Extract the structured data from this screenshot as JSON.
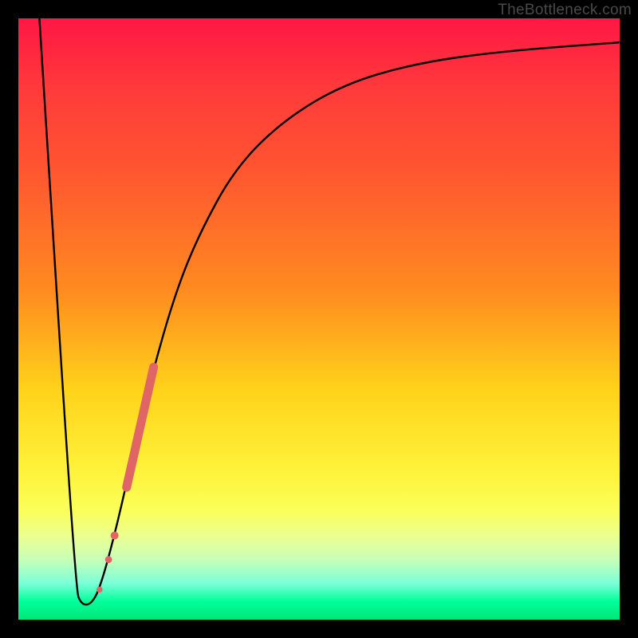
{
  "watermark": "TheBottleneck.com",
  "colors": {
    "curve_stroke": "#000000",
    "marker_fill": "#e06666",
    "marker_stroke": "#e06666"
  },
  "chart_data": {
    "type": "line",
    "title": "",
    "xlabel": "",
    "ylabel": "",
    "xlim": [
      0,
      100
    ],
    "ylim": [
      0,
      100
    ],
    "curve_points": [
      {
        "x": 3.5,
        "y": 100
      },
      {
        "x": 9.5,
        "y": 5
      },
      {
        "x": 10.5,
        "y": 2.5
      },
      {
        "x": 12.0,
        "y": 2.5
      },
      {
        "x": 13.5,
        "y": 5
      },
      {
        "x": 16.0,
        "y": 14
      },
      {
        "x": 18.5,
        "y": 25
      },
      {
        "x": 22.0,
        "y": 40
      },
      {
        "x": 26.0,
        "y": 54
      },
      {
        "x": 30.0,
        "y": 64
      },
      {
        "x": 36.0,
        "y": 75
      },
      {
        "x": 44.0,
        "y": 83
      },
      {
        "x": 54.0,
        "y": 89
      },
      {
        "x": 66.0,
        "y": 92.5
      },
      {
        "x": 80.0,
        "y": 94.5
      },
      {
        "x": 100.0,
        "y": 96
      }
    ],
    "marker_segment": {
      "start": {
        "x": 18.0,
        "y": 22
      },
      "end": {
        "x": 22.5,
        "y": 42
      }
    },
    "marker_dots": [
      {
        "x": 16.0,
        "y": 14
      },
      {
        "x": 15.0,
        "y": 10
      },
      {
        "x": 13.5,
        "y": 5
      }
    ]
  }
}
